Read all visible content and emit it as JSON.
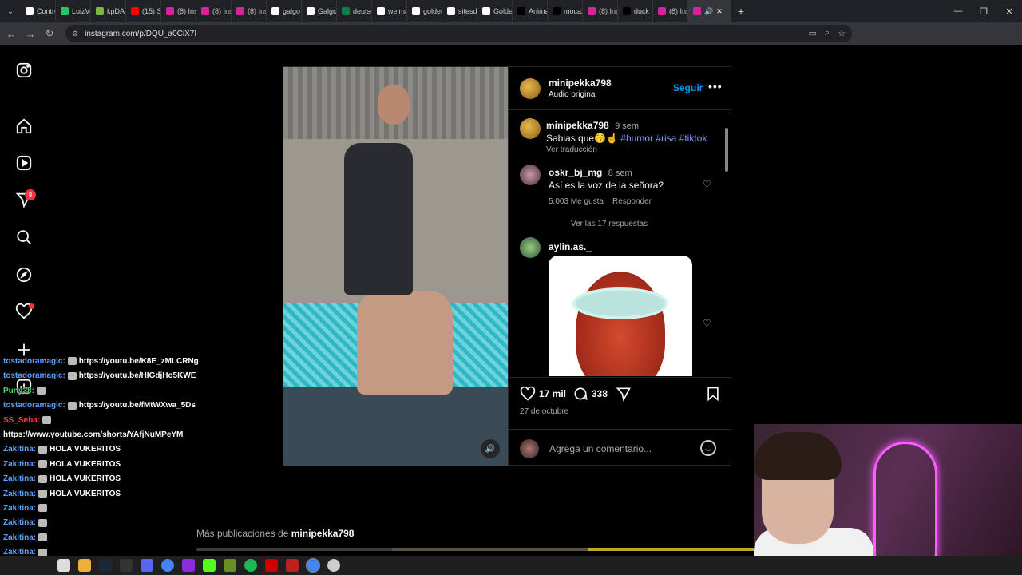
{
  "browser": {
    "tabs": [
      {
        "label": "Contro",
        "color": "#ffffff"
      },
      {
        "label": "LuizVu",
        "color": "#29c46a"
      },
      {
        "label": "kpDAv",
        "color": "#7ab648"
      },
      {
        "label": "(15) Sc",
        "color": "#ff0000"
      },
      {
        "label": "(8) Ins",
        "color": "#d6249f"
      },
      {
        "label": "(8) Ins",
        "color": "#d6249f"
      },
      {
        "label": "(8) Ins",
        "color": "#d6249f"
      },
      {
        "label": "galgo",
        "color": "#ffffff"
      },
      {
        "label": "Galgo",
        "color": "#ffffff"
      },
      {
        "label": "deutsc",
        "color": "#0b8043"
      },
      {
        "label": "weima",
        "color": "#ffffff"
      },
      {
        "label": "golder",
        "color": "#ffffff"
      },
      {
        "label": "sitesde",
        "color": "#ffffff"
      },
      {
        "label": "Golder",
        "color": "#ffffff"
      },
      {
        "label": "Anima",
        "color": "#000000"
      },
      {
        "label": "moca2",
        "color": "#000000"
      },
      {
        "label": "(8) Ins",
        "color": "#d6249f"
      },
      {
        "label": "duck e",
        "color": "#000000"
      },
      {
        "label": "(8) Ins",
        "color": "#d6249f"
      }
    ],
    "active_tab_icon": "instagram-icon",
    "url": "instagram.com/p/DQU_a0CiX7I"
  },
  "post": {
    "username": "minipekka798",
    "audio": "Audio original",
    "follow_label": "Seguir",
    "caption": {
      "user": "minipekka798",
      "time": "9 sem",
      "text": "Sabias que😚☝",
      "tags": "#humor #risa #tiktok",
      "translate": "Ver traducción"
    },
    "comments": [
      {
        "user": "oskr_bj_mg",
        "time": "8 sem",
        "text": "Así es la voz de la señora?",
        "likes": "5.003 Me gusta",
        "reply": "Responder",
        "replies": "Ver las 17 respuestas"
      },
      {
        "user": "aylin.as._"
      }
    ],
    "likes_count": "17 mil",
    "comments_count": "338",
    "date": "27 de octubre",
    "add_comment_placeholder": "Agrega un comentario..."
  },
  "more_from": {
    "prefix": "Más publicaciones de ",
    "user": "minipekka798"
  },
  "chat": [
    {
      "user": "tostadoramagic:",
      "msg": "https://youtu.be/K8E_zMLCRNg",
      "color": "blue"
    },
    {
      "user": "tostadoramagic:",
      "msg": "https://youtu.be/HIGdjHo5KWE",
      "color": "blue"
    },
    {
      "user": "Puny38:",
      "msg": "",
      "color": "green"
    },
    {
      "user": "tostadoramagic:",
      "msg": "https://youtu.be/fMtWXwa_5Ds",
      "color": "blue"
    },
    {
      "user": "SS_Seba:",
      "msg": "",
      "color": "red"
    },
    {
      "user": "",
      "msg": "https://www.youtube.com/shorts/YAfjNuMPeYM",
      "color": "blue"
    },
    {
      "user": "Zakitina:",
      "msg": "HOLA VUKERITOS",
      "color": "blue"
    },
    {
      "user": "Zakitina:",
      "msg": "HOLA VUKERITOS",
      "color": "blue"
    },
    {
      "user": "Zakitina:",
      "msg": "HOLA VUKERITOS",
      "color": "blue"
    },
    {
      "user": "Zakitina:",
      "msg": "HOLA VUKERITOS",
      "color": "blue"
    },
    {
      "user": "Zakitina:",
      "msg": "",
      "color": "blue"
    },
    {
      "user": "Zakitina:",
      "msg": "",
      "color": "blue"
    },
    {
      "user": "Zakitina:",
      "msg": "",
      "color": "blue"
    },
    {
      "user": "Zakitina:",
      "msg": "",
      "color": "blue"
    }
  ],
  "sidebar": {
    "notifications_badge": "8"
  }
}
